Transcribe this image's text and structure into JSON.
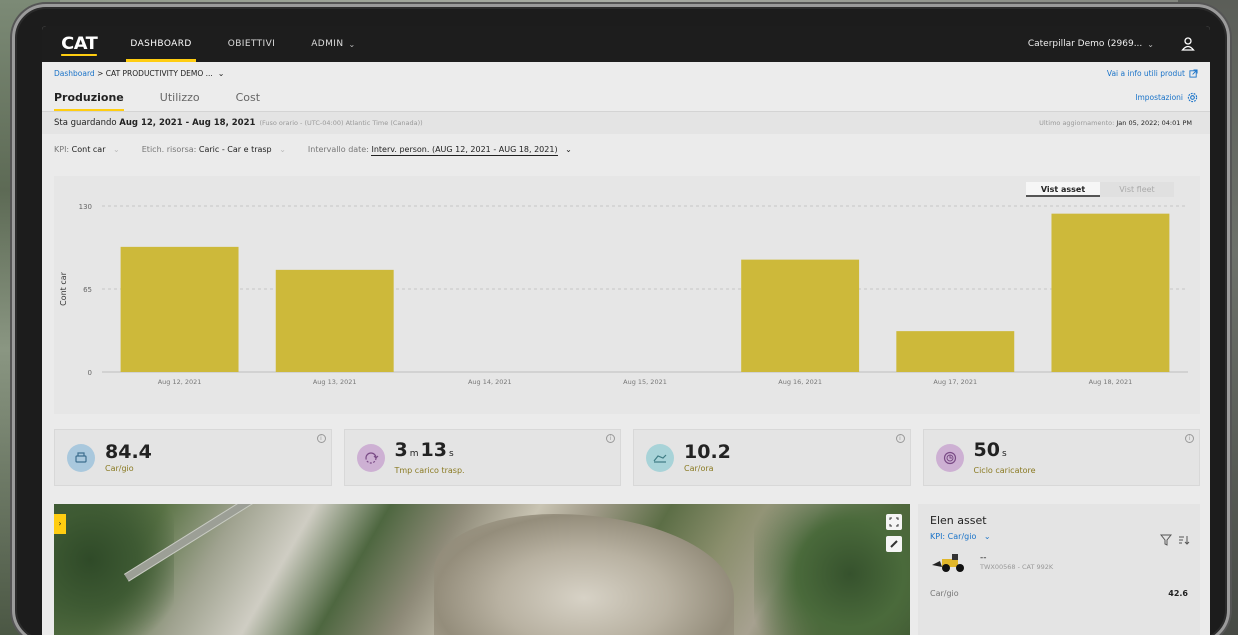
{
  "nav": {
    "logo": "CAT",
    "items": [
      "DASHBOARD",
      "OBIETTIVI",
      "ADMIN"
    ],
    "account": "Caterpillar Demo (2969..."
  },
  "breadcrumb": {
    "root": "Dashboard",
    "separator": ">",
    "current": "CAT PRODUCTIVITY DEMO ...",
    "product_link": "Vai a info utili produt"
  },
  "tabs": [
    "Produzione",
    "Utilizzo",
    "Cost"
  ],
  "settings_label": "Impostazioni",
  "view": {
    "prefix": "Sta guardando",
    "range": "Aug 12, 2021 - Aug 18, 2021",
    "timezone": "(Fuso orario - (UTC-04:00) Atlantic Time (Canada))",
    "updated_label": "Ultimo aggiornamento:",
    "updated_value": "Jan 05, 2022; 04:01 PM"
  },
  "filters": {
    "kpi_label": "KPI:",
    "kpi_value": "Cont car",
    "tag_label": "Etich. risorsa:",
    "tag_value": "Caric - Car e trasp",
    "date_label": "Intervallo date:",
    "date_value": "Interv. person. (AUG 12, 2021 - AUG 18, 2021)"
  },
  "view_toggle": {
    "asset": "Vist asset",
    "fleet": "Vist fleet"
  },
  "chart_data": {
    "type": "bar",
    "categories": [
      "Aug 12, 2021",
      "Aug 13, 2021",
      "Aug 14, 2021",
      "Aug 15, 2021",
      "Aug 16, 2021",
      "Aug 17, 2021",
      "Aug 18, 2021"
    ],
    "values": [
      98,
      80,
      0,
      0,
      88,
      32,
      124
    ],
    "ylabel": "Cont car",
    "yticks": [
      0,
      65,
      130
    ],
    "ylim": [
      0,
      130
    ],
    "grid": "dashed",
    "bar_color": "#cdb93a"
  },
  "kpis": [
    {
      "value": "84.4",
      "label": "Car/gio",
      "icon": "loader-bucket-icon",
      "icon_color": "#a9c8dd"
    },
    {
      "value_main": "3",
      "unit1": "m",
      "value_sec": "13",
      "unit2": "s",
      "label": "Tmp carico trasp.",
      "icon": "cycle-icon",
      "icon_color": "#cdb0d3"
    },
    {
      "value": "10.2",
      "label": "Car/ora",
      "icon": "truck-load-icon",
      "icon_color": "#a8d3d8"
    },
    {
      "value": "50",
      "unit": "s",
      "label": "Ciclo caricatore",
      "icon": "timer-cycle-icon",
      "icon_color": "#cdb0d3"
    }
  ],
  "assets": {
    "title": "Elen asset",
    "kpi_label": "KPI: Car/gio",
    "row_name": "--",
    "row_model": "TWX00568 - CAT 992K",
    "metric_label": "Car/gio",
    "metric_value": "42.6"
  }
}
